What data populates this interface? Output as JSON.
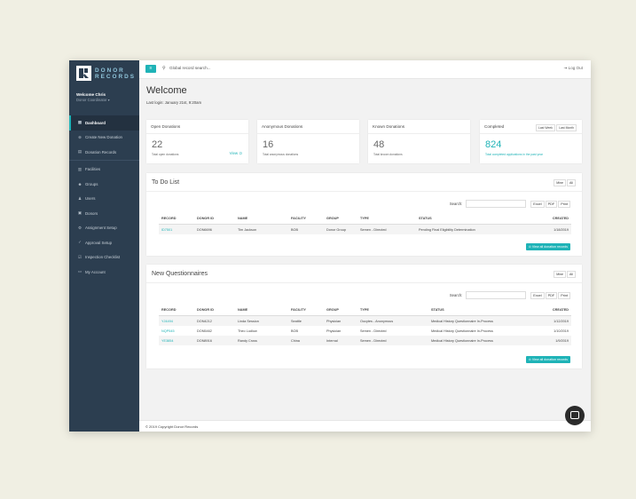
{
  "brand": {
    "line1": "DONOR",
    "line2": "RECORDS"
  },
  "user": {
    "welcome": "Welcome Chris",
    "role": "Donor Coordinator"
  },
  "nav": [
    {
      "label": "Dashboard",
      "icon": "grid-icon"
    },
    {
      "label": "Create New Donation",
      "icon": "plus-icon"
    },
    {
      "label": "Donation Records",
      "icon": "list-icon"
    },
    {
      "label": "Facilities",
      "icon": "chart-icon"
    },
    {
      "label": "Groups",
      "icon": "group-icon"
    },
    {
      "label": "Users",
      "icon": "user-icon"
    },
    {
      "label": "Donors",
      "icon": "id-card-icon"
    },
    {
      "label": "Assignment Setup",
      "icon": "gear-icon"
    },
    {
      "label": "Approval Setup",
      "icon": "check-icon"
    },
    {
      "label": "Inspection Checklist",
      "icon": "clipboard-icon"
    },
    {
      "label": "My Account",
      "icon": "account-icon"
    }
  ],
  "topbar": {
    "search_placeholder": "Global record search...",
    "logout": "Log Out"
  },
  "header": {
    "title": "Welcome",
    "last_login": "Last login: January 21st, 9:20am"
  },
  "stats": [
    {
      "title": "Open Donations",
      "value": "22",
      "sub": "Total open donations",
      "link": "View"
    },
    {
      "title": "Anonymous Donations",
      "value": "16",
      "sub": "Total anonymous donations"
    },
    {
      "title": "Known Donations",
      "value": "48",
      "sub": "Total known donations"
    },
    {
      "title": "Completed",
      "value": "824",
      "sub": "Total completed applications in the past year",
      "ranges": [
        "Last Week",
        "Last Month"
      ]
    }
  ],
  "todo": {
    "title": "To Do List",
    "toggle": [
      "Mine",
      "All"
    ],
    "search_label": "Search:",
    "buttons": [
      "Excel",
      "PDF",
      "Print"
    ],
    "columns": [
      "RECORD",
      "DONOR ID",
      "NAME",
      "FACILITY",
      "GROUP",
      "TYPE",
      "STATUS",
      "CREATED"
    ],
    "rows": [
      [
        "ID7501",
        "DON6696",
        "Tim Jackson",
        "BOB",
        "Donor Group",
        "Semen - Directed",
        "Pending Final Eligibility Determination",
        "1/18/2019"
      ]
    ],
    "view_all": "View all donation records"
  },
  "questionnaires": {
    "title": "New Questionnaires",
    "toggle": [
      "Mine",
      "All"
    ],
    "search_label": "Search:",
    "buttons": [
      "Excel",
      "PDF",
      "Print"
    ],
    "columns": [
      "RECORD",
      "DONOR ID",
      "NAME",
      "FACILITY",
      "GROUP",
      "TYPE",
      "STATUS",
      "CREATED"
    ],
    "rows": [
      [
        "YJ4494",
        "DON4212",
        "Linda Session",
        "Seattle",
        "Physician",
        "Oocytes - Anonymous",
        "Medical History Questionnaire In-Process",
        "1/12/2019"
      ],
      [
        "NQP545",
        "DON5462",
        "Theo Ludlow",
        "BOB",
        "Physician",
        "Semen - Directed",
        "Medical History Questionnaire In-Process",
        "1/10/2019"
      ],
      [
        "YE3854",
        "DON8916",
        "Randy Cross",
        "China",
        "Internal",
        "Semen - Directed",
        "Medical History Questionnaire In-Process",
        "1/9/2019"
      ]
    ],
    "view_all": "View all donation records"
  },
  "footer": "© 2019 Copyright Donor Records",
  "colors": {
    "accent": "#1fb3b7",
    "sidebar": "#2c3e50"
  }
}
